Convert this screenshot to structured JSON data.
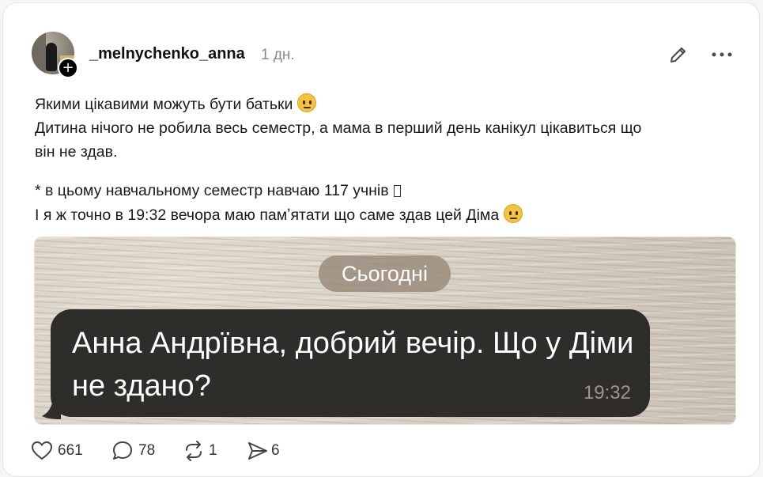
{
  "post": {
    "username": "_melnychenko_anna",
    "time": "1 дн.",
    "lines": [
      "Якими цікавими можуть бути батьки",
      "Дитина нічого не робила весь семестр, а мама в перший день канікул цікавиться що",
      "він не здав.",
      "* в цьому навчальному семестр навчаю 117 учнів",
      "І я ж точно в 19:32 вечора маю памʼятати що саме здав цей Діма"
    ]
  },
  "image": {
    "date_pill": "Сьогодні",
    "message": "Анна Андрївна, добрий вечір. Що у Діми не здано?",
    "message_time": "19:32"
  },
  "actions": {
    "likes": "661",
    "comments": "78",
    "reposts": "1",
    "shares": "6"
  },
  "icons": {
    "edit": "pencil-icon",
    "more": "more-dots-icon",
    "like": "heart-icon",
    "comment": "comment-bubble-icon",
    "repost": "repost-icon",
    "share": "send-icon"
  }
}
